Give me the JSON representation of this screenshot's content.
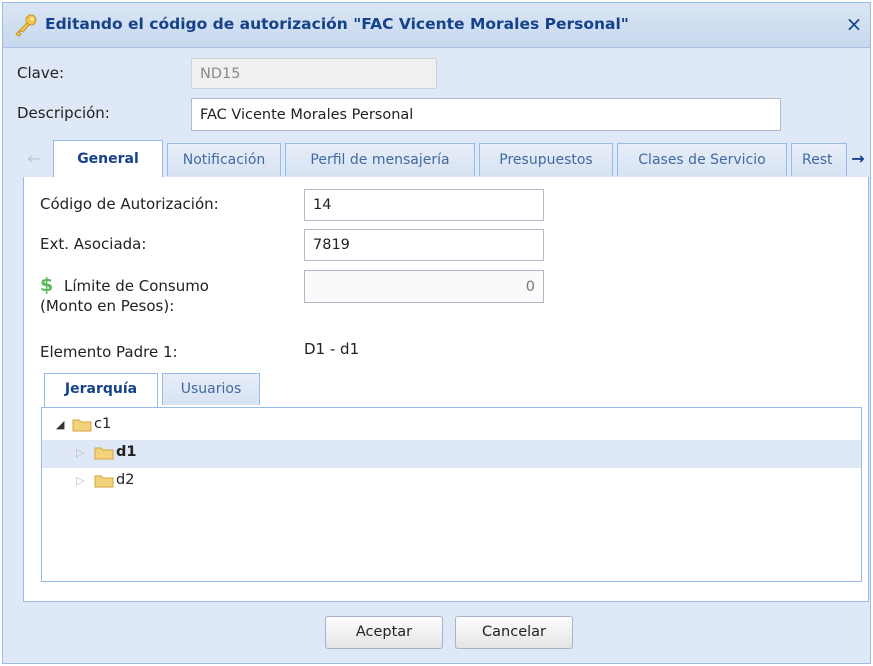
{
  "window": {
    "title": "Editando el código de autorización \"FAC Vicente Morales Personal\"",
    "close_glyph": "×"
  },
  "form": {
    "clave_label": "Clave:",
    "clave_value": "ND15",
    "descripcion_label": "Descripción:",
    "descripcion_value": "FAC Vicente Morales Personal"
  },
  "tabs": [
    {
      "label": "General",
      "active": true
    },
    {
      "label": "Notificación"
    },
    {
      "label": "Perfil de mensajería"
    },
    {
      "label": "Presupuestos"
    },
    {
      "label": "Clases de Servicio"
    },
    {
      "label": "Rest"
    }
  ],
  "general": {
    "codigo_label": "Código de Autorización:",
    "codigo_value": "14",
    "ext_label": "Ext. Asociada:",
    "ext_value": "7819",
    "limite_label_1": "Límite de Consumo",
    "limite_label_2": "(Monto en Pesos):",
    "limite_value": "0",
    "dollar_glyph": "$",
    "padre_label": "Elemento Padre 1:",
    "padre_value": "D1 - d1"
  },
  "inner_tabs": [
    {
      "label": "Jerarquía",
      "active": true
    },
    {
      "label": "Usuarios"
    }
  ],
  "tree": [
    {
      "label": "c1",
      "level": 0,
      "expanded": true
    },
    {
      "label": "d1",
      "level": 1,
      "selected": true
    },
    {
      "label": "d2",
      "level": 1
    }
  ],
  "buttons": {
    "accept": "Aceptar",
    "cancel": "Cancelar"
  },
  "colors": {
    "header_text": "#15428b",
    "border": "#99bbe8",
    "window_bg": "#dfe8f6",
    "money_icon": "#5cb85c"
  }
}
